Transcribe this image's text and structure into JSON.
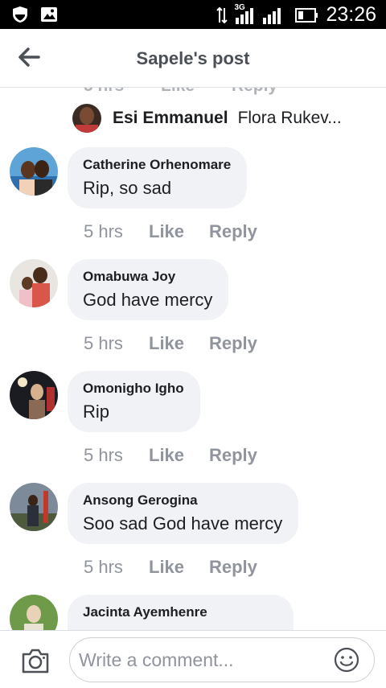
{
  "status_bar": {
    "time": "23:26",
    "network_label": "3G",
    "icons": [
      "shield-icon",
      "gallery-icon",
      "data-transfer-icon",
      "signal-icon",
      "signal-icon",
      "battery-icon"
    ]
  },
  "header": {
    "title": "Sapele's post",
    "back_icon": "arrow-left-icon"
  },
  "peek_row": {
    "time": "5 hrs",
    "like": "Like",
    "reply": "Reply"
  },
  "reply_preview": {
    "name": "Esi Emmanuel",
    "text": "Flora Rukev..."
  },
  "comments": [
    {
      "name": "Catherine Orhenomare",
      "text": "Rip, so sad",
      "time": "5 hrs",
      "like": "Like",
      "reply": "Reply"
    },
    {
      "name": "Omabuwa Joy",
      "text": "God have mercy",
      "time": "5 hrs",
      "like": "Like",
      "reply": "Reply"
    },
    {
      "name": "Omonigho Igho",
      "text": "Rip",
      "time": "5 hrs",
      "like": "Like",
      "reply": "Reply"
    },
    {
      "name": "Ansong Gerogina",
      "text": "Soo sad God have mercy",
      "time": "5 hrs",
      "like": "Like",
      "reply": "Reply"
    },
    {
      "name": "Jacinta Ayemhenre",
      "text": "",
      "time": "",
      "like": "",
      "reply": ""
    }
  ],
  "composer": {
    "placeholder": "Write a comment...",
    "camera_icon": "camera-icon",
    "emoji_icon": "smiley-icon"
  }
}
